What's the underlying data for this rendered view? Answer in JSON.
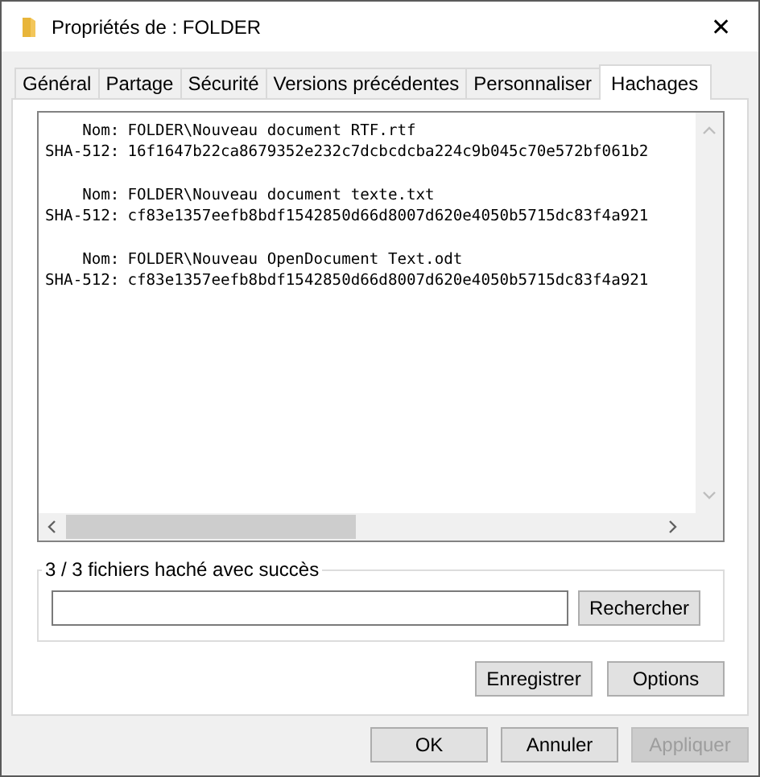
{
  "window": {
    "title": "Propriétés de : FOLDER",
    "close": "✕"
  },
  "tabs": [
    {
      "label": "Général",
      "selected": false
    },
    {
      "label": "Partage",
      "selected": false
    },
    {
      "label": "Sécurité",
      "selected": false
    },
    {
      "label": "Versions précédentes",
      "selected": false
    },
    {
      "label": "Personnaliser",
      "selected": false
    },
    {
      "label": "Hachages",
      "selected": true
    }
  ],
  "results": [
    {
      "name_label": "Nom:",
      "name": "FOLDER\\Nouveau document RTF.rtf",
      "hash_label": "SHA-512:",
      "hash": "16f1647b22ca8679352e232c7dcbcdcba224c9b045c70e572bf061b2"
    },
    {
      "name_label": "Nom:",
      "name": "FOLDER\\Nouveau document texte.txt",
      "hash_label": "SHA-512:",
      "hash": "cf83e1357eefb8bdf1542850d66d8007d620e4050b5715dc83f4a921"
    },
    {
      "name_label": "Nom:",
      "name": "FOLDER\\Nouveau OpenDocument Text.odt",
      "hash_label": "SHA-512:",
      "hash": "cf83e1357eefb8bdf1542850d66d8007d620e4050b5715dc83f4a921"
    }
  ],
  "search_group": {
    "title": "3 / 3 fichiers haché avec succès",
    "button": "Rechercher"
  },
  "actions": [
    "Enregistrer",
    "Options"
  ],
  "footer": [
    {
      "label": "OK",
      "disabled": false
    },
    {
      "label": "Annuler",
      "disabled": false
    },
    {
      "label": "Appliquer",
      "disabled": true
    }
  ]
}
